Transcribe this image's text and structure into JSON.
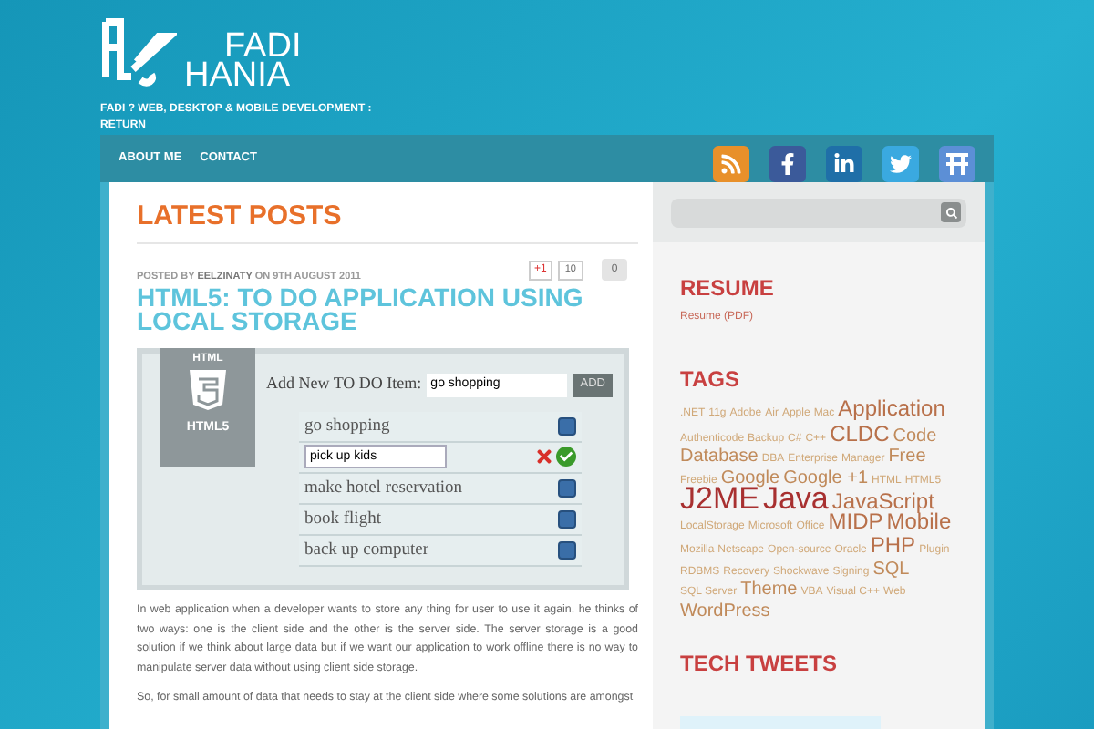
{
  "site": {
    "logo_line1": "FADI",
    "logo_line2": "HANIA",
    "tagline": "FADI ? WEB, DESKTOP & MOBILE DEVELOPMENT : RETURN"
  },
  "nav": {
    "items": [
      {
        "label": "ABOUT ME",
        "selected": false
      },
      {
        "label": "CONTACT",
        "selected": false
      }
    ],
    "social": [
      {
        "kind": "rss"
      },
      {
        "kind": "facebook"
      },
      {
        "kind": "linkedin"
      },
      {
        "kind": "twitter"
      },
      {
        "kind": "friendfeed"
      }
    ]
  },
  "main": {
    "heading": "LATEST POSTS",
    "post": {
      "posted_by_prefix": "POSTED BY",
      "author": "EELZINATY",
      "date": "ON 9TH AUGUST 2011",
      "plus_one_label": "+1",
      "plus_one_count": "10",
      "comment_count": "0",
      "title": "HTML5: TO DO APPLICATION USING LOCAL STORAGE",
      "figure": {
        "badge_top": "HTML",
        "badge_bottom": "HTML5",
        "add_label": "Add New TO DO Item:",
        "add_value": "go shopping",
        "add_button": "ADD",
        "items": [
          {
            "kind": "text",
            "text": "go shopping"
          },
          {
            "kind": "editing",
            "text": "pick up kids"
          },
          {
            "kind": "text",
            "text": "make hotel reservation"
          },
          {
            "kind": "text",
            "text": "book flight"
          },
          {
            "kind": "text",
            "text": "back up computer"
          }
        ]
      },
      "paragraphs": [
        "In web application when a developer wants to store any thing for user to use it again, he thinks of two ways: one is the client side and the other is the server side. The server storage is a good solution if we think about large data but if we want our application to work offline there is no way to manipulate server data without using client side storage.",
        "So, for small amount of data that needs to stay at the client side where some solutions are amongst"
      ]
    }
  },
  "sidebar": {
    "resume_heading": "RESUME",
    "resume_link": "Resume (PDF)",
    "tags_heading": "TAGS",
    "tags": [
      {
        "label": ".NET",
        "kind": "s"
      },
      {
        "label": "11g",
        "kind": "s"
      },
      {
        "label": "Adobe",
        "kind": "s"
      },
      {
        "label": "Air",
        "kind": "s"
      },
      {
        "label": "Apple",
        "kind": "s"
      },
      {
        "label": "Mac",
        "kind": "s"
      },
      {
        "label": "Application",
        "kind": "l"
      },
      {
        "label": "Authenticode",
        "kind": "s"
      },
      {
        "label": "Backup",
        "kind": "s"
      },
      {
        "label": "C#",
        "kind": "s"
      },
      {
        "label": "C++",
        "kind": "s"
      },
      {
        "label": "CLDC",
        "kind": "l"
      },
      {
        "label": "Code",
        "kind": "m"
      },
      {
        "label": "Database",
        "kind": "m"
      },
      {
        "label": "DBA",
        "kind": "s"
      },
      {
        "label": "Enterprise",
        "kind": "s"
      },
      {
        "label": "Manager",
        "kind": "s"
      },
      {
        "label": "Free",
        "kind": "m"
      },
      {
        "label": "Freebie",
        "kind": "s"
      },
      {
        "label": "Google",
        "kind": "m"
      },
      {
        "label": "Google +1",
        "kind": "m"
      },
      {
        "label": "HTML",
        "kind": "s"
      },
      {
        "label": "HTML5",
        "kind": "s"
      },
      {
        "label": "J2ME",
        "kind": "xl"
      },
      {
        "label": "Java",
        "kind": "xl"
      },
      {
        "label": "JavaScript",
        "kind": "l"
      },
      {
        "label": "LocalStorage",
        "kind": "s"
      },
      {
        "label": "Microsoft",
        "kind": "s"
      },
      {
        "label": "Office",
        "kind": "s"
      },
      {
        "label": "MIDP",
        "kind": "l"
      },
      {
        "label": "Mobile",
        "kind": "l"
      },
      {
        "label": "Mozilla",
        "kind": "s"
      },
      {
        "label": "Netscape",
        "kind": "s"
      },
      {
        "label": "Open-source",
        "kind": "s"
      },
      {
        "label": "Oracle",
        "kind": "s"
      },
      {
        "label": "PHP",
        "kind": "l"
      },
      {
        "label": "Plugin",
        "kind": "s"
      },
      {
        "label": "RDBMS",
        "kind": "s"
      },
      {
        "label": "Recovery",
        "kind": "s"
      },
      {
        "label": "Shockwave",
        "kind": "s"
      },
      {
        "label": "Signing",
        "kind": "s"
      },
      {
        "label": "SQL",
        "kind": "m"
      },
      {
        "label": "SQL Server",
        "kind": "s"
      },
      {
        "label": "Theme",
        "kind": "m"
      },
      {
        "label": "VBA",
        "kind": "s"
      },
      {
        "label": "Visual C++",
        "kind": "s"
      },
      {
        "label": "Web",
        "kind": "s"
      },
      {
        "label": "WordPress",
        "kind": "m"
      }
    ],
    "tweets_heading": "TECH TWEETS"
  }
}
